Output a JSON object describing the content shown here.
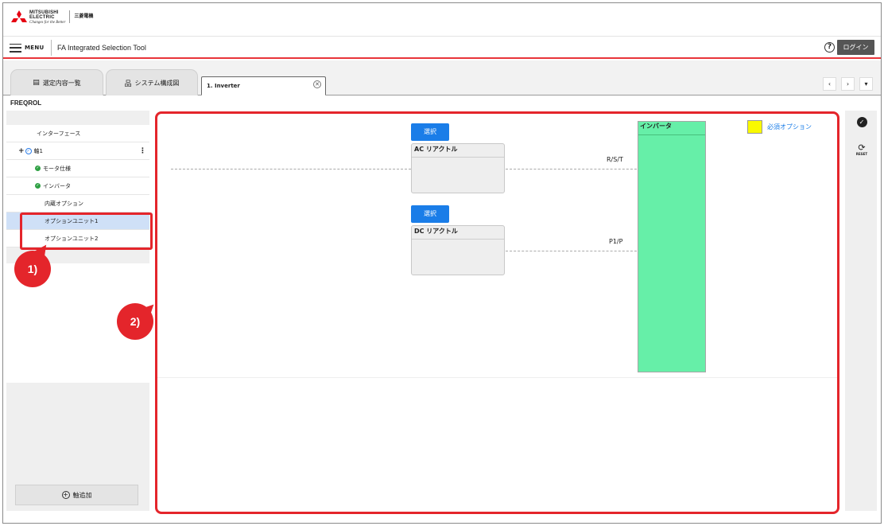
{
  "logo": {
    "name_line1": "MITSUBISHI",
    "name_line2": "ELECTRIC",
    "tagline": "Changes for the Better",
    "japanese": "三菱電機"
  },
  "menu": {
    "menu_label": "MENU",
    "app_title": "FA Integrated Selection Tool",
    "help_icon": "?",
    "login_label": "ログイン"
  },
  "tabs": [
    {
      "label": "選定内容一覧",
      "icon": "list-icon"
    },
    {
      "label": "システム構成図",
      "icon": "diagram-icon"
    },
    {
      "label": "1. Inverter",
      "active": true
    }
  ],
  "tab_nav": {
    "prev": "‹",
    "next": "›",
    "more": "▾"
  },
  "product_title": "FREQROL",
  "tree": {
    "interface": "インターフェース",
    "axis1": "軸1",
    "motor_spec": "モータ仕様",
    "inverter": "インバータ",
    "builtin_option": "内蔵オプション",
    "option_unit1": "オプションユニット1",
    "option_unit2": "オプションユニット2"
  },
  "add_axis_label": "軸追加",
  "canvas": {
    "select_label": "選択",
    "ac_reactor": "AC リアクトル",
    "dc_reactor": "DC リアクトル",
    "terminal_rst": "R/S/T",
    "terminal_p1p": "P1/P",
    "inverter_label": "インバータ",
    "legend_text": "必須オプション",
    "legend_color": "#f9f900",
    "inverter_color": "#66efa8"
  },
  "tools": {
    "reset_label": "RESET"
  },
  "annotations": {
    "callout1": "1)",
    "callout2": "2)",
    "color": "#e4252b"
  }
}
